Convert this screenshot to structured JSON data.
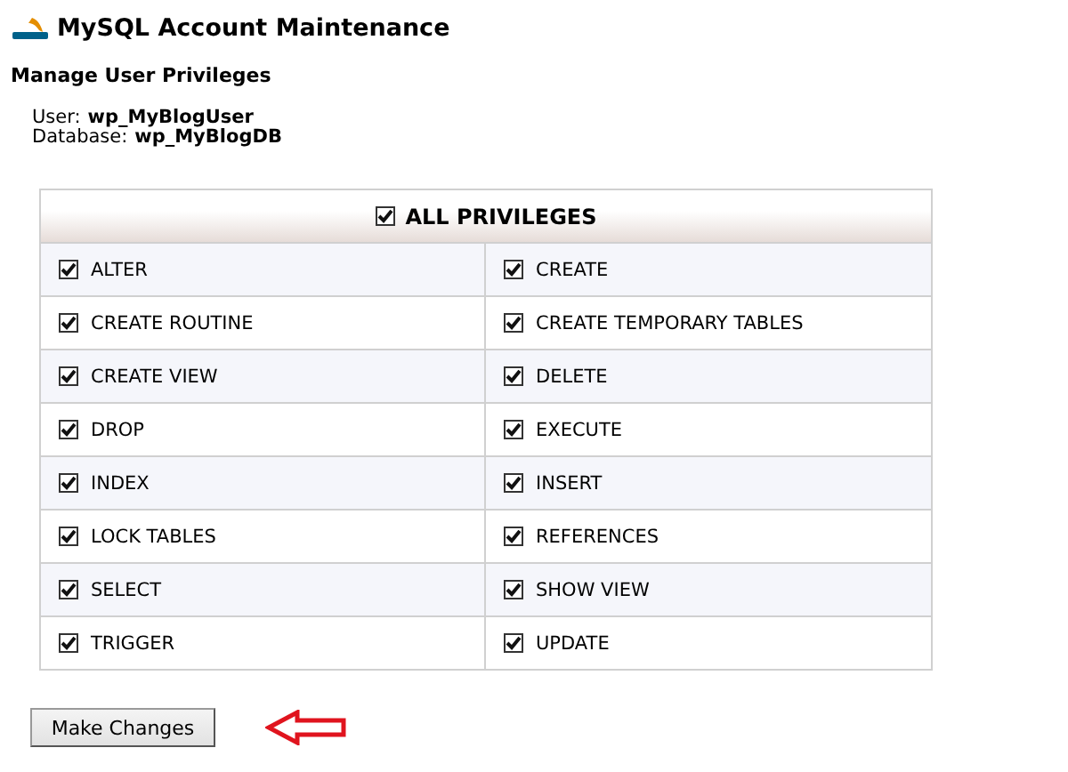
{
  "page": {
    "title": "MySQL Account Maintenance",
    "subtitle": "Manage User Privileges"
  },
  "account": [
    {
      "label": "User:",
      "value": "wp_MyBlogUser"
    },
    {
      "label": "Database:",
      "value": "wp_MyBlogDB"
    }
  ],
  "all_privileges": {
    "label": "ALL PRIVILEGES",
    "checked": true
  },
  "privileges": [
    {
      "label": "ALTER",
      "checked": true
    },
    {
      "label": "CREATE",
      "checked": true
    },
    {
      "label": "CREATE ROUTINE",
      "checked": true
    },
    {
      "label": "CREATE TEMPORARY TABLES",
      "checked": true
    },
    {
      "label": "CREATE VIEW",
      "checked": true
    },
    {
      "label": "DELETE",
      "checked": true
    },
    {
      "label": "DROP",
      "checked": true
    },
    {
      "label": "EXECUTE",
      "checked": true
    },
    {
      "label": "INDEX",
      "checked": true
    },
    {
      "label": "INSERT",
      "checked": true
    },
    {
      "label": "LOCK TABLES",
      "checked": true
    },
    {
      "label": "REFERENCES",
      "checked": true
    },
    {
      "label": "SELECT",
      "checked": true
    },
    {
      "label": "SHOW VIEW",
      "checked": true
    },
    {
      "label": "TRIGGER",
      "checked": true
    },
    {
      "label": "UPDATE",
      "checked": true
    }
  ],
  "submit_button": "Make Changes"
}
